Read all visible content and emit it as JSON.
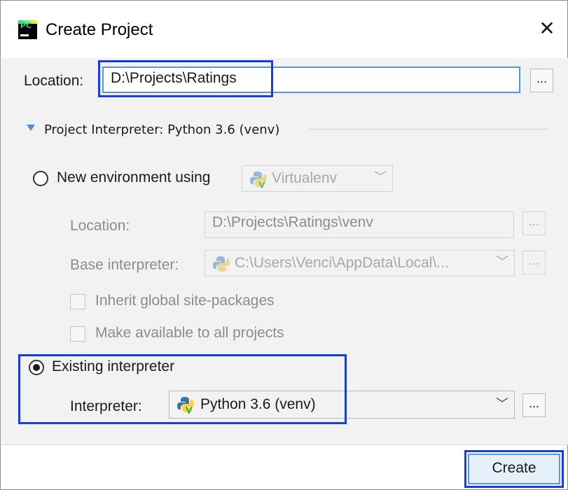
{
  "window": {
    "title": "Create Project",
    "app_icon_text": "PC",
    "close_glyph": "✕"
  },
  "location": {
    "label": "Location:",
    "value": "D:\\Projects\\Ratings",
    "browse_label": "..."
  },
  "interpreter_section": {
    "title": "Project Interpreter: Python 3.6 (venv)",
    "expanded": true
  },
  "new_environment": {
    "label": "New environment using",
    "selected": false,
    "tool": "Virtualenv",
    "location_label": "Location:",
    "location_value": "D:\\Projects\\Ratings\\venv",
    "base_interpreter_label": "Base interpreter:",
    "base_interpreter_value": "C:\\Users\\Venci\\AppData\\Local\\...",
    "inherit_label": "Inherit global site-packages",
    "inherit_checked": false,
    "make_available_label": "Make available to all projects",
    "make_available_checked": false,
    "browse_label": "..."
  },
  "existing_interpreter": {
    "label": "Existing interpreter",
    "selected": true,
    "interpreter_label": "Interpreter:",
    "interpreter_value": "Python 3.6 (venv)",
    "browse_label": "..."
  },
  "footer": {
    "create_label": "Create"
  },
  "colors": {
    "highlight": "#1a3be0",
    "focus": "#4d9be8",
    "toggle": "#4a8fd6"
  },
  "icons": [
    "pycharm-app-icon",
    "close-icon",
    "chevron-down-icon",
    "python-icon",
    "virtualenv-icon"
  ]
}
